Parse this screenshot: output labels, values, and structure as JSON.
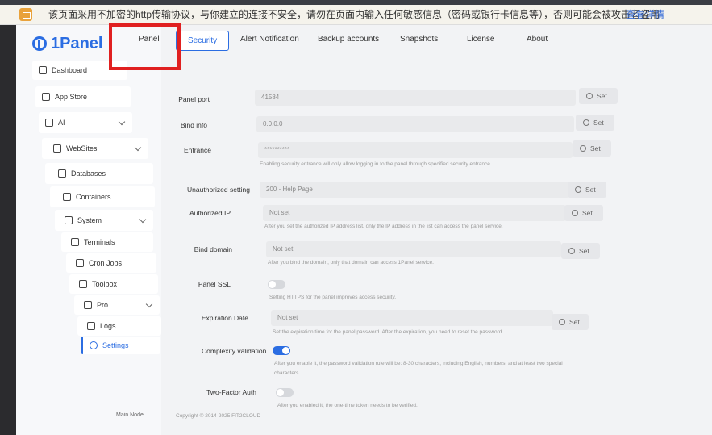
{
  "warning": {
    "message": "该页面采用不加密的http传输协议，与你建立的连接不安全，请勿在页面内输入任何敏感信息（密码或银行卡信息等），否则可能会被攻击者盗用",
    "link": "查看详情"
  },
  "brand": {
    "name": "1Panel"
  },
  "sidebar": {
    "items": [
      {
        "label": "Dashboard",
        "icon": "home-icon"
      },
      {
        "label": "App Store",
        "icon": "grid-icon"
      },
      {
        "label": "AI",
        "icon": "ai-icon"
      },
      {
        "label": "WebSites",
        "icon": "globe-icon"
      },
      {
        "label": "Databases",
        "icon": "database-icon"
      },
      {
        "label": "Containers",
        "icon": "container-icon"
      },
      {
        "label": "System",
        "icon": "system-icon"
      },
      {
        "label": "Terminals",
        "icon": "terminal-icon"
      },
      {
        "label": "Cron Jobs",
        "icon": "clock-icon"
      },
      {
        "label": "Toolbox",
        "icon": "toolbox-icon"
      },
      {
        "label": "Pro",
        "icon": "crown-icon"
      },
      {
        "label": "Logs",
        "icon": "logs-icon"
      },
      {
        "label": "Settings",
        "icon": "gear-icon"
      }
    ],
    "node": "Main Node"
  },
  "tabs": [
    "Panel",
    "Security",
    "Alert Notification",
    "Backup accounts",
    "Snapshots",
    "License",
    "About"
  ],
  "accent": "#2b6de2",
  "highlight_color": "#e02020",
  "settings": {
    "set_label": "Set",
    "panel_port": {
      "label": "Panel port",
      "value": "41584"
    },
    "bind_info": {
      "label": "Bind info",
      "value": "0.0.0.0"
    },
    "entrance": {
      "label": "Entrance",
      "value": "**********",
      "help": "Enabling security entrance will only allow logging in to the panel through specified security entrance."
    },
    "unauthorized": {
      "label": "Unauthorized setting",
      "value": "200 - Help Page"
    },
    "authorized_ip": {
      "label": "Authorized IP",
      "value": "Not set",
      "help": "After you set the authorized IP address list, only the IP address in the list can access the panel service."
    },
    "bind_domain": {
      "label": "Bind domain",
      "value": "Not set",
      "help": "After you bind the domain, only that domain can access 1Panel service."
    },
    "panel_ssl": {
      "label": "Panel SSL",
      "help": "Setting HTTPS for the panel improves access security."
    },
    "expiration": {
      "label": "Expiration Date",
      "value": "Not set",
      "help": "Set the expiration time for the panel password. After the expiration, you need to reset the password."
    },
    "complexity": {
      "label": "Complexity validation",
      "help1": "After you enable it, the password validation rule will be: 8-30 characters, including English, numbers, and at least two special",
      "help2": "characters."
    },
    "two_factor": {
      "label": "Two-Factor Auth",
      "help": "After you enabled it, the one-time token needs to be verified."
    }
  },
  "footer": "Copyright © 2014-2025 FIT2CLOUD"
}
